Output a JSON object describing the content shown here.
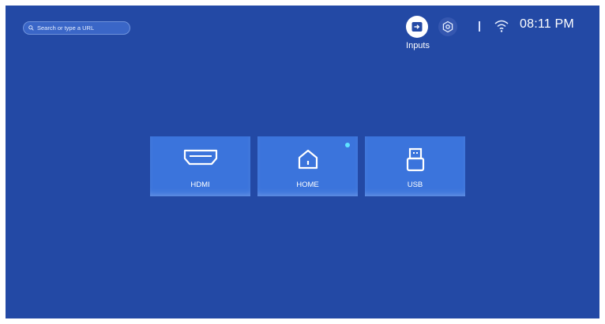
{
  "search": {
    "placeholder": "Search or type a URL",
    "icon": "search-icon"
  },
  "topbar": {
    "inputs_label": "Inputs",
    "inputs_icon": "input-source-icon",
    "settings_icon": "settings-icon",
    "wifi_icon": "wifi-icon",
    "time": "08:11 PM"
  },
  "tiles": [
    {
      "label": "HDMI",
      "icon": "hdmi-icon",
      "active": false
    },
    {
      "label": "HOME",
      "icon": "home-icon",
      "active": true
    },
    {
      "label": "USB",
      "icon": "usb-icon",
      "active": false
    }
  ],
  "colors": {
    "background": "#2349a5",
    "tile": "#3b74dc",
    "indicator": "#5ee3ff",
    "text": "#ffffff"
  }
}
